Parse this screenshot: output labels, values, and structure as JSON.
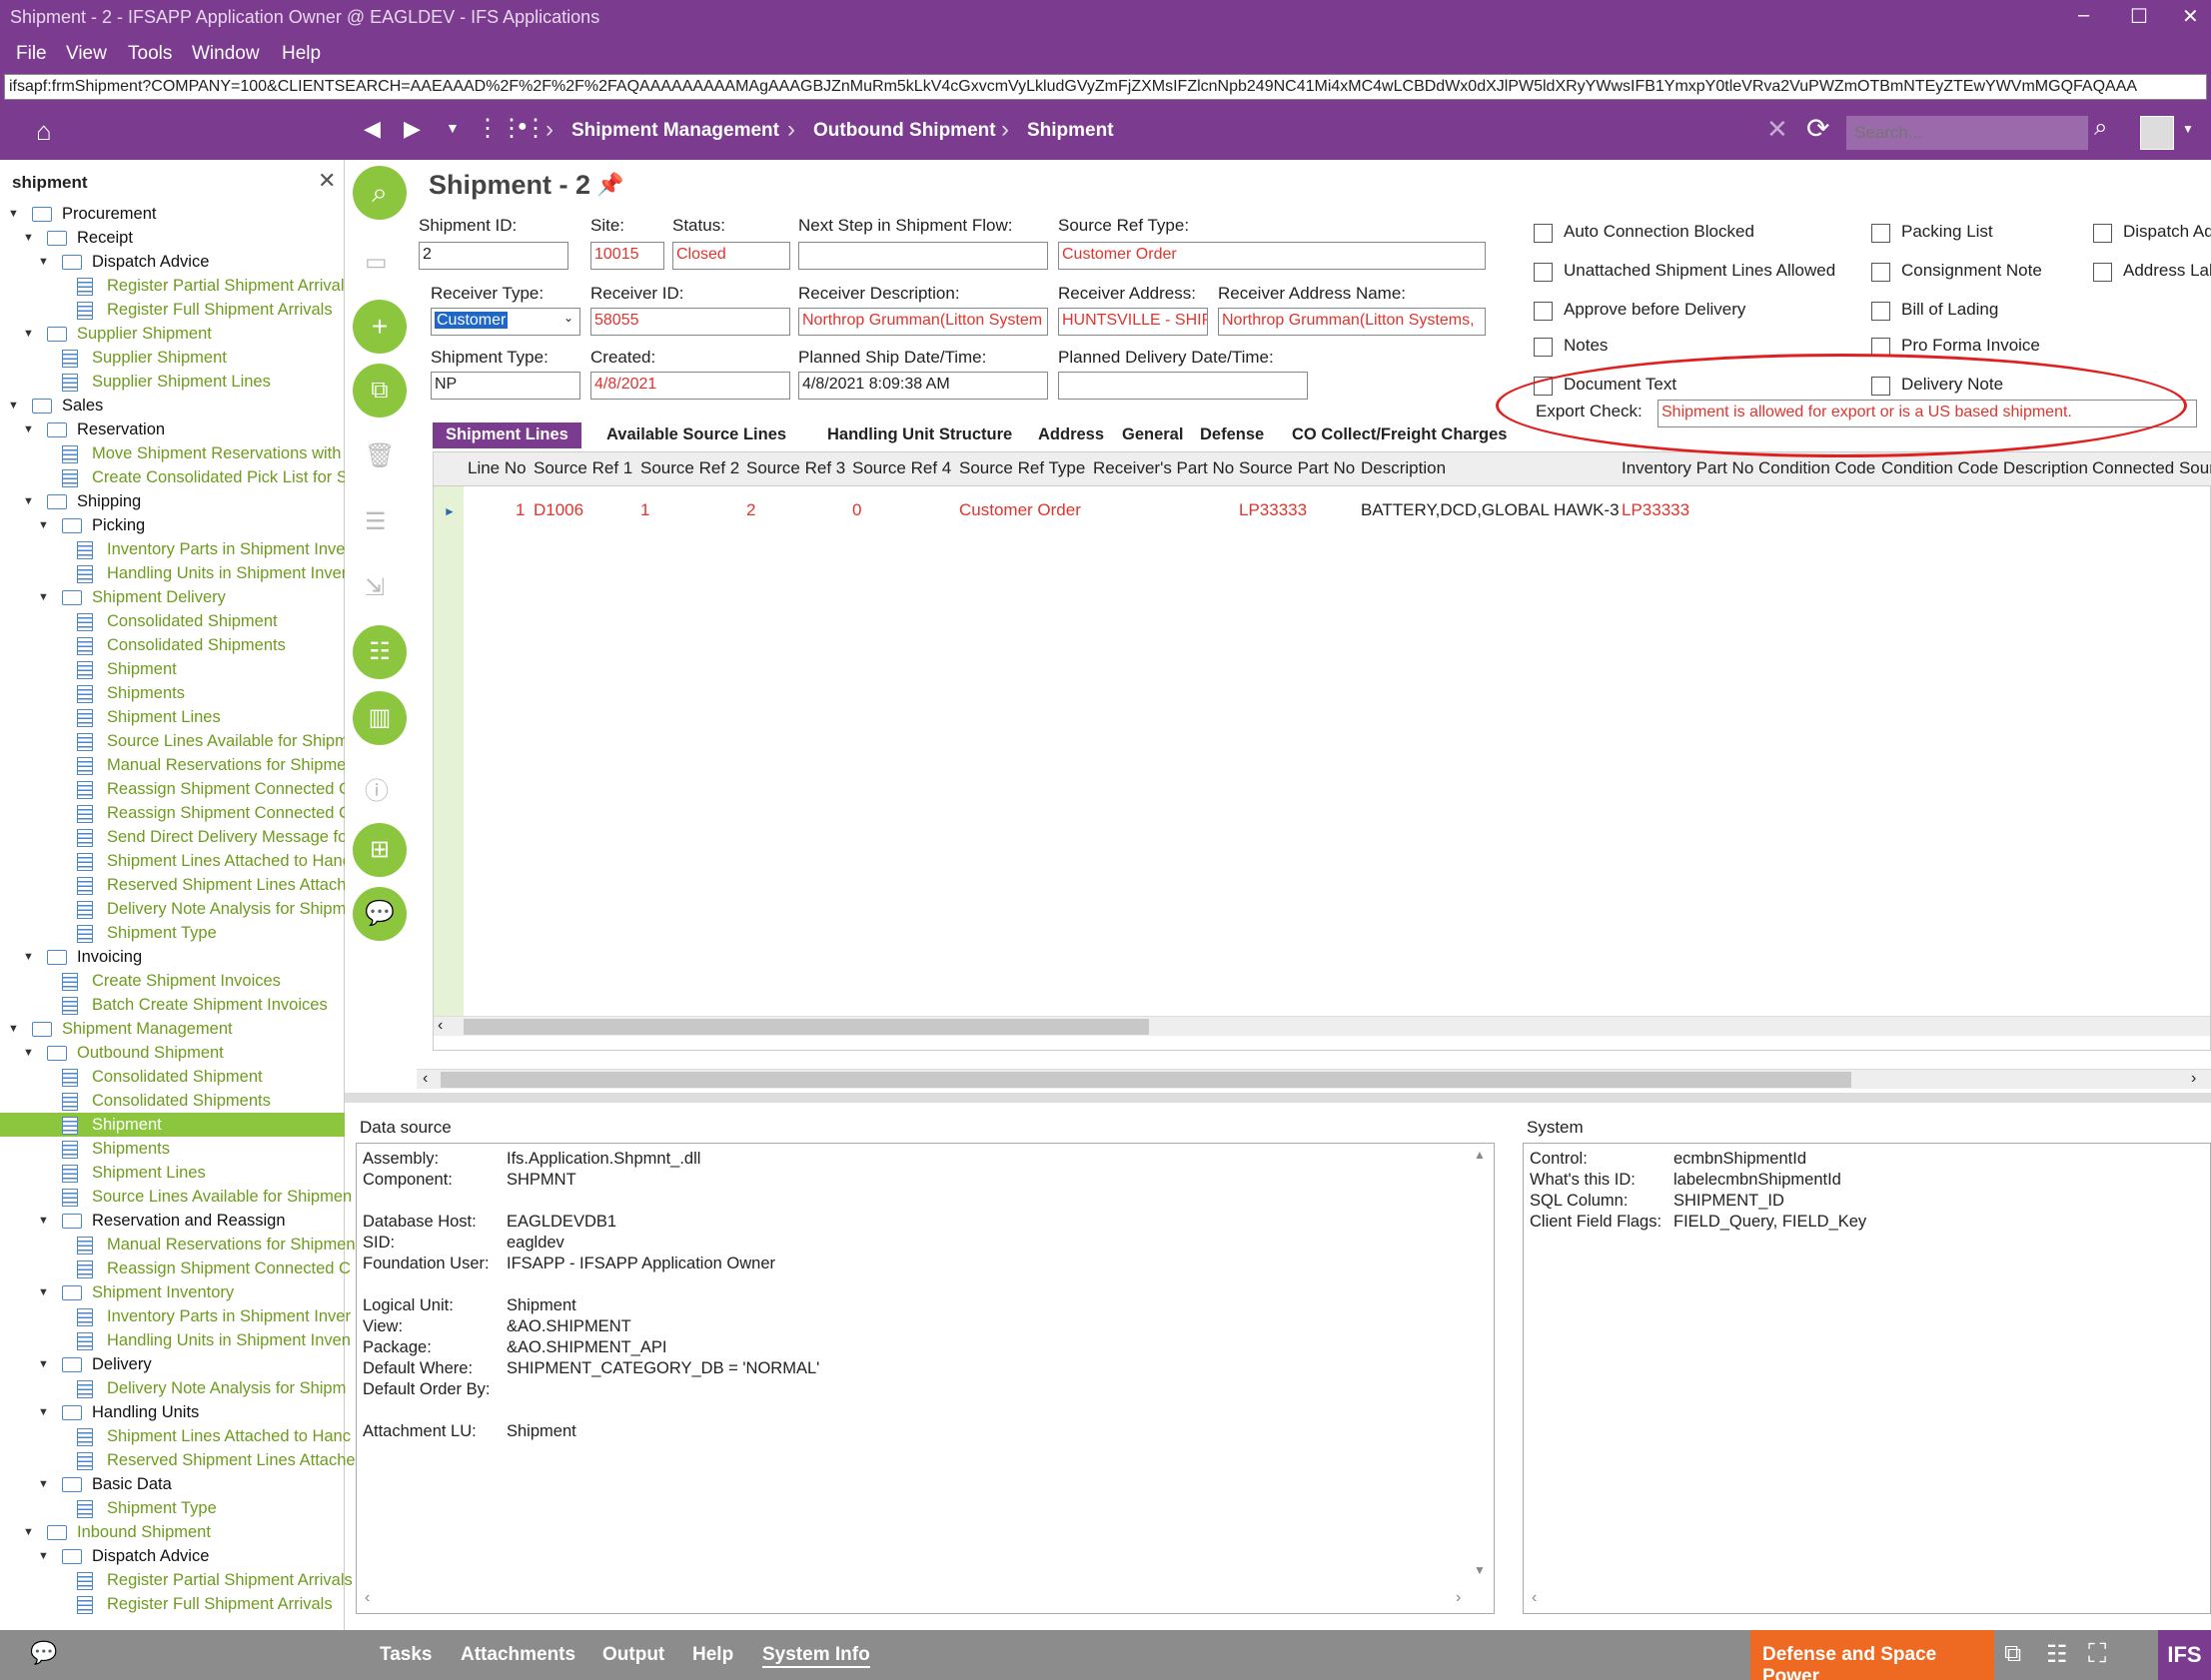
{
  "window": {
    "title": "Shipment - 2 - IFSAPP Application Owner @ EAGLDEV - IFS Applications",
    "minimize": "–",
    "maximize": "☐",
    "close": "✕"
  },
  "menu": [
    "File",
    "View",
    "Tools",
    "Window",
    "Help"
  ],
  "url": "ifsapf:frmShipment?COMPANY=100&CLIENTSEARCH=AAEAAAD%2F%2F%2F%2FAQAAAAAAAAAMAgAAAGBJZnMuRm5kLkV4cGxvcmVyLkludGVyZmFjZXMsIFZlcnNpb249NC41Mi4xMC4wLCBDdWx0dXJlPW5ldXRyYWwsIFB1YmxpY0tleVRva2VuPWZmOTBmNTEyZTEwYWVmMGQFAQAAA",
  "breadcrumb": [
    "Shipment Management",
    "Outbound Shipment",
    "Shipment"
  ],
  "search": {
    "placeholder": "Search..."
  },
  "sidebar": {
    "title": "shipment",
    "close": "✕"
  },
  "tree": [
    {
      "label": "Procurement",
      "type": "folder",
      "level": 0,
      "open": true
    },
    {
      "label": "Receipt",
      "type": "folder",
      "level": 1,
      "open": true
    },
    {
      "label": "Dispatch Advice",
      "type": "folder",
      "level": 2,
      "open": true
    },
    {
      "label": "Register Partial Shipment Arrivals",
      "type": "leaf",
      "level": 3
    },
    {
      "label": "Register Full Shipment Arrivals",
      "type": "leaf",
      "level": 3
    },
    {
      "label": "Supplier Shipment",
      "type": "folder",
      "level": 1,
      "open": true,
      "color": "green"
    },
    {
      "label": "Supplier Shipment",
      "type": "leaf",
      "level": 2
    },
    {
      "label": "Supplier Shipment Lines",
      "type": "leaf",
      "level": 2
    },
    {
      "label": "Sales",
      "type": "folder",
      "level": 0,
      "open": true
    },
    {
      "label": "Reservation",
      "type": "folder",
      "level": 1,
      "open": true
    },
    {
      "label": "Move Shipment Reservations with T",
      "type": "leaf",
      "level": 2
    },
    {
      "label": "Create Consolidated Pick List for S",
      "type": "leaf",
      "level": 2
    },
    {
      "label": "Shipping",
      "type": "folder",
      "level": 1,
      "open": true
    },
    {
      "label": "Picking",
      "type": "folder",
      "level": 2,
      "open": true
    },
    {
      "label": "Inventory Parts in Shipment Inver",
      "type": "leaf",
      "level": 3
    },
    {
      "label": "Handling Units in Shipment Inven",
      "type": "leaf",
      "level": 3
    },
    {
      "label": "Shipment Delivery",
      "type": "folder",
      "level": 2,
      "open": true,
      "color": "green"
    },
    {
      "label": "Consolidated Shipment",
      "type": "leaf",
      "level": 3
    },
    {
      "label": "Consolidated Shipments",
      "type": "leaf",
      "level": 3
    },
    {
      "label": "Shipment",
      "type": "leaf",
      "level": 3
    },
    {
      "label": "Shipments",
      "type": "leaf",
      "level": 3
    },
    {
      "label": "Shipment Lines",
      "type": "leaf",
      "level": 3
    },
    {
      "label": "Source Lines Available for Shipm",
      "type": "leaf",
      "level": 3
    },
    {
      "label": "Manual Reservations for Shipmer",
      "type": "leaf",
      "level": 3
    },
    {
      "label": "Reassign Shipment Connected C",
      "type": "leaf",
      "level": 3
    },
    {
      "label": "Reassign Shipment Connected C",
      "type": "leaf",
      "level": 3
    },
    {
      "label": "Send Direct Delivery Message fo",
      "type": "leaf",
      "level": 3
    },
    {
      "label": "Shipment Lines Attached to Hanc",
      "type": "leaf",
      "level": 3
    },
    {
      "label": "Reserved Shipment Lines Attache",
      "type": "leaf",
      "level": 3
    },
    {
      "label": "Delivery Note Analysis for Shipm",
      "type": "leaf",
      "level": 3
    },
    {
      "label": "Shipment Type",
      "type": "leaf",
      "level": 3
    },
    {
      "label": "Invoicing",
      "type": "folder",
      "level": 1,
      "open": true
    },
    {
      "label": "Create Shipment Invoices",
      "type": "leaf",
      "level": 2
    },
    {
      "label": "Batch Create Shipment Invoices",
      "type": "leaf",
      "level": 2
    },
    {
      "label": "Shipment Management",
      "type": "folder",
      "level": 0,
      "open": true,
      "color": "green"
    },
    {
      "label": "Outbound Shipment",
      "type": "folder",
      "level": 1,
      "open": true,
      "color": "green"
    },
    {
      "label": "Consolidated Shipment",
      "type": "leaf",
      "level": 2
    },
    {
      "label": "Consolidated Shipments",
      "type": "leaf",
      "level": 2
    },
    {
      "label": "Shipment",
      "type": "leaf",
      "level": 2,
      "selected": true
    },
    {
      "label": "Shipments",
      "type": "leaf",
      "level": 2
    },
    {
      "label": "Shipment Lines",
      "type": "leaf",
      "level": 2
    },
    {
      "label": "Source Lines Available for Shipmen",
      "type": "leaf",
      "level": 2
    },
    {
      "label": "Reservation and Reassign",
      "type": "folder",
      "level": 2,
      "open": true
    },
    {
      "label": "Manual Reservations for Shipmen",
      "type": "leaf",
      "level": 3
    },
    {
      "label": "Reassign Shipment Connected C",
      "type": "leaf",
      "level": 3
    },
    {
      "label": "Shipment Inventory",
      "type": "folder",
      "level": 2,
      "open": true,
      "color": "green"
    },
    {
      "label": "Inventory Parts in Shipment Inver",
      "type": "leaf",
      "level": 3
    },
    {
      "label": "Handling Units in Shipment Inven",
      "type": "leaf",
      "level": 3
    },
    {
      "label": "Delivery",
      "type": "folder",
      "level": 2,
      "open": true
    },
    {
      "label": "Delivery Note Analysis for Shipm",
      "type": "leaf",
      "level": 3
    },
    {
      "label": "Handling Units",
      "type": "folder",
      "level": 2,
      "open": true
    },
    {
      "label": "Shipment Lines Attached to Hanc",
      "type": "leaf",
      "level": 3
    },
    {
      "label": "Reserved Shipment Lines Attache",
      "type": "leaf",
      "level": 3
    },
    {
      "label": "Basic Data",
      "type": "folder",
      "level": 2,
      "open": true
    },
    {
      "label": "Shipment Type",
      "type": "leaf",
      "level": 3
    },
    {
      "label": "Inbound Shipment",
      "type": "folder",
      "level": 1,
      "open": true,
      "color": "green"
    },
    {
      "label": "Dispatch Advice",
      "type": "folder",
      "level": 2,
      "open": true
    },
    {
      "label": "Register Partial Shipment Arrivals",
      "type": "leaf",
      "level": 3
    },
    {
      "label": "Register Full Shipment Arrivals",
      "type": "leaf",
      "level": 3
    }
  ],
  "form": {
    "title": "Shipment - 2",
    "shipment_id": {
      "label": "Shipment ID:",
      "value": "2"
    },
    "site": {
      "label": "Site:",
      "value": "10015"
    },
    "status": {
      "label": "Status:",
      "value": "Closed"
    },
    "next_step": {
      "label": "Next Step in Shipment Flow:",
      "value": ""
    },
    "source_ref_type": {
      "label": "Source Ref Type:",
      "value": "Customer Order"
    },
    "receiver_type": {
      "label": "Receiver Type:",
      "value": "Customer"
    },
    "receiver_id": {
      "label": "Receiver ID:",
      "value": "58055"
    },
    "receiver_desc": {
      "label": "Receiver Description:",
      "value": "Northrop Grumman(Litton System"
    },
    "receiver_addr": {
      "label": "Receiver Address:",
      "value": "HUNTSVILLE - SHIP"
    },
    "receiver_addr_name": {
      "label": "Receiver Address Name:",
      "value": "Northrop Grumman(Litton Systems,"
    },
    "shipment_type": {
      "label": "Shipment Type:",
      "value": "NP"
    },
    "created": {
      "label": "Created:",
      "value": "4/8/2021"
    },
    "planned_ship": {
      "label": "Planned Ship Date/Time:",
      "value": "4/8/2021 8:09:38 AM"
    },
    "planned_delivery": {
      "label": "Planned Delivery Date/Time:",
      "value": ""
    },
    "export_check": {
      "label": "Export Check:",
      "value": "Shipment is allowed for export or is a US based shipment."
    }
  },
  "checkboxes": [
    {
      "label": "Auto Connection Blocked",
      "checked": false
    },
    {
      "label": "Unattached Shipment Lines Allowed",
      "checked": false
    },
    {
      "label": "Approve before Delivery",
      "checked": false
    },
    {
      "label": "Notes",
      "checked": false
    },
    {
      "label": "Document Text",
      "checked": false
    },
    {
      "label": "Packing List",
      "checked": false
    },
    {
      "label": "Consignment Note",
      "checked": false
    },
    {
      "label": "Bill of Lading",
      "checked": false
    },
    {
      "label": "Pro Forma Invoice",
      "checked": false
    },
    {
      "label": "Delivery Note",
      "checked": false
    },
    {
      "label": "Dispatch Adv",
      "checked": false
    },
    {
      "label": "Address Lab",
      "checked": false
    }
  ],
  "tabs": [
    "Shipment Lines",
    "Available Source Lines",
    "Handling Unit Structure",
    "Address",
    "General",
    "Defense",
    "CO Collect/Freight Charges"
  ],
  "grid": {
    "columns": [
      "Line No",
      "Source Ref 1",
      "Source Ref 2",
      "Source Ref 3",
      "Source Ref 4",
      "Source Ref Type",
      "Receiver's Part No",
      "Source Part No",
      "Description",
      "Inventory Part No",
      "Condition Code",
      "Condition Code Description",
      "Connected Sour"
    ],
    "rows": [
      [
        "1",
        "D1006",
        "1",
        "2",
        "0",
        "Customer Order",
        "",
        "LP33333",
        "BATTERY,DCD,GLOBAL HAWK-3",
        "LP33333",
        "",
        "",
        ""
      ]
    ],
    "row_marker": "►"
  },
  "datasource": {
    "title": "Data source",
    "items": [
      {
        "k": "Assembly:",
        "v": "Ifs.Application.Shpmnt_.dll"
      },
      {
        "k": "Component:",
        "v": "SHPMNT"
      },
      {
        "k": "Database Host:",
        "v": "EAGLDEVDB1"
      },
      {
        "k": "SID:",
        "v": "eagldev"
      },
      {
        "k": "Foundation User:",
        "v": "IFSAPP - IFSAPP Application Owner"
      },
      {
        "k": "Logical Unit:",
        "v": "Shipment"
      },
      {
        "k": "View:",
        "v": "&AO.SHIPMENT"
      },
      {
        "k": "Package:",
        "v": "&AO.SHIPMENT_API"
      },
      {
        "k": "Default Where:",
        "v": "SHIPMENT_CATEGORY_DB = 'NORMAL'"
      },
      {
        "k": "Default Order By:",
        "v": ""
      },
      {
        "k": "Attachment LU:",
        "v": "Shipment"
      }
    ]
  },
  "system": {
    "title": "System",
    "items": [
      {
        "k": "Control:",
        "v": "ecmbnShipmentId"
      },
      {
        "k": "What's this ID:",
        "v": "labelecmbnShipmentId"
      },
      {
        "k": "SQL Column:",
        "v": "SHIPMENT_ID"
      },
      {
        "k": "Client Field Flags:",
        "v": "FIELD_Query, FIELD_Key"
      }
    ]
  },
  "statusbar": {
    "tasks": "Tasks",
    "attachments": "Attachments",
    "output": "Output",
    "help": "Help",
    "system_info": "System Info",
    "company": "Defense and Space Power",
    "logo": "IFS"
  },
  "colors": {
    "brand": "#7b3b8f",
    "accent": "#8cc63f",
    "error_text": "#e0342e",
    "orange": "#ee6a22"
  }
}
